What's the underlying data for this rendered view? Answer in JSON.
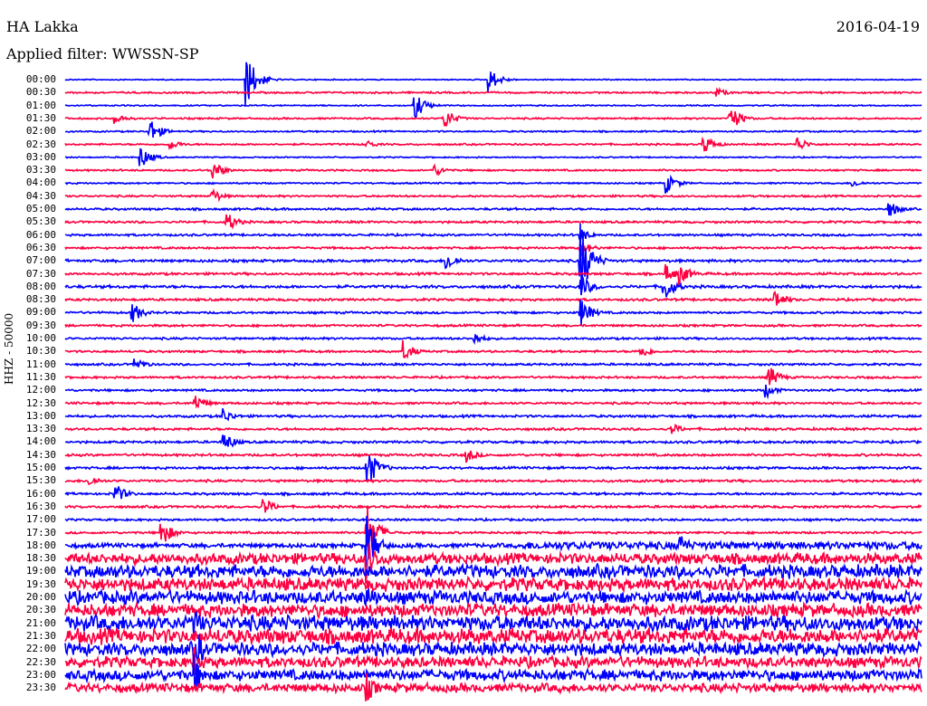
{
  "header": {
    "station": "HA Lakka",
    "date": "2016-04-19",
    "filter": "Applied filter: WWSSN-SP"
  },
  "chart_data": {
    "type": "line",
    "title": "HA Lakka 2016-04-19",
    "ylabel": "HHZ - 50000",
    "xlabel": "",
    "minutes_per_line": 30,
    "colors": {
      "even": "#0000ff",
      "odd": "#ff0040"
    },
    "row_labels": [
      "00:00",
      "00:30",
      "01:00",
      "01:30",
      "02:00",
      "02:30",
      "03:00",
      "03:30",
      "04:00",
      "04:30",
      "05:00",
      "05:30",
      "06:00",
      "06:30",
      "07:00",
      "07:30",
      "08:00",
      "08:30",
      "09:00",
      "09:30",
      "10:00",
      "10:30",
      "11:00",
      "11:30",
      "12:00",
      "12:30",
      "13:00",
      "13:30",
      "14:00",
      "14:30",
      "15:00",
      "15:30",
      "16:00",
      "16:30",
      "17:00",
      "17:30",
      "18:00",
      "18:30",
      "19:00",
      "19:30",
      "20:00",
      "20:30",
      "21:00",
      "21:30",
      "22:00",
      "22:30",
      "23:00",
      "23:30"
    ],
    "noise_levels": [
      0.5,
      0.8,
      0.6,
      0.8,
      0.7,
      0.8,
      0.6,
      0.8,
      0.7,
      0.9,
      1,
      1,
      1,
      1,
      1.2,
      1.1,
      1.3,
      1.1,
      1,
      1,
      1,
      1,
      1,
      1,
      1,
      1,
      1.1,
      1.1,
      1.1,
      1.1,
      1.1,
      1.1,
      1.1,
      1.1,
      1,
      1,
      2,
      5,
      6,
      6,
      6,
      6,
      7,
      7,
      6,
      5,
      5,
      4
    ],
    "events": [
      [
        0,
        6.3,
        35
      ],
      [
        0,
        14.8,
        15
      ],
      [
        1,
        22.8,
        6
      ],
      [
        2,
        12.2,
        18
      ],
      [
        3,
        1.7,
        8
      ],
      [
        3,
        13.2,
        16
      ],
      [
        3,
        23.2,
        20
      ],
      [
        4,
        2.9,
        18
      ],
      [
        5,
        3.6,
        8
      ],
      [
        5,
        10.5,
        6
      ],
      [
        5,
        22.3,
        14
      ],
      [
        5,
        25.6,
        10
      ],
      [
        6,
        2.6,
        14
      ],
      [
        7,
        5.1,
        14
      ],
      [
        7,
        12.9,
        8
      ],
      [
        8,
        21,
        14
      ],
      [
        8,
        27.5,
        6
      ],
      [
        9,
        5.1,
        10
      ],
      [
        10,
        28.8,
        12
      ],
      [
        11,
        5.6,
        14
      ],
      [
        12,
        18,
        10
      ],
      [
        13,
        18,
        12
      ],
      [
        14,
        18,
        50
      ],
      [
        14,
        13.3,
        14
      ],
      [
        15,
        21,
        12
      ],
      [
        15,
        21.5,
        14
      ],
      [
        16,
        18,
        18
      ],
      [
        16,
        20.9,
        22
      ],
      [
        17,
        24.8,
        14
      ],
      [
        18,
        18,
        20
      ],
      [
        18,
        2.3,
        14
      ],
      [
        20,
        14.3,
        8
      ],
      [
        21,
        11.8,
        14
      ],
      [
        21,
        20.1,
        10
      ],
      [
        22,
        2.4,
        10
      ],
      [
        23,
        24.6,
        16
      ],
      [
        24,
        24.5,
        10
      ],
      [
        25,
        4.5,
        12
      ],
      [
        26,
        5.5,
        10
      ],
      [
        27,
        21.2,
        8
      ],
      [
        28,
        5.5,
        14
      ],
      [
        29,
        14,
        10
      ],
      [
        30,
        10.5,
        30
      ],
      [
        31,
        0.8,
        8
      ],
      [
        32,
        1.7,
        14
      ],
      [
        33,
        6.9,
        12
      ],
      [
        35,
        3.3,
        20
      ],
      [
        35,
        10.5,
        40
      ],
      [
        36,
        10.5,
        40
      ],
      [
        36,
        21.5,
        16
      ],
      [
        37,
        10.5,
        30
      ],
      [
        40,
        10.5,
        20
      ],
      [
        42,
        4.5,
        20
      ],
      [
        44,
        4.5,
        30
      ],
      [
        45,
        4.5,
        20
      ],
      [
        46,
        4.5,
        25
      ],
      [
        47,
        10.5,
        20
      ]
    ]
  }
}
